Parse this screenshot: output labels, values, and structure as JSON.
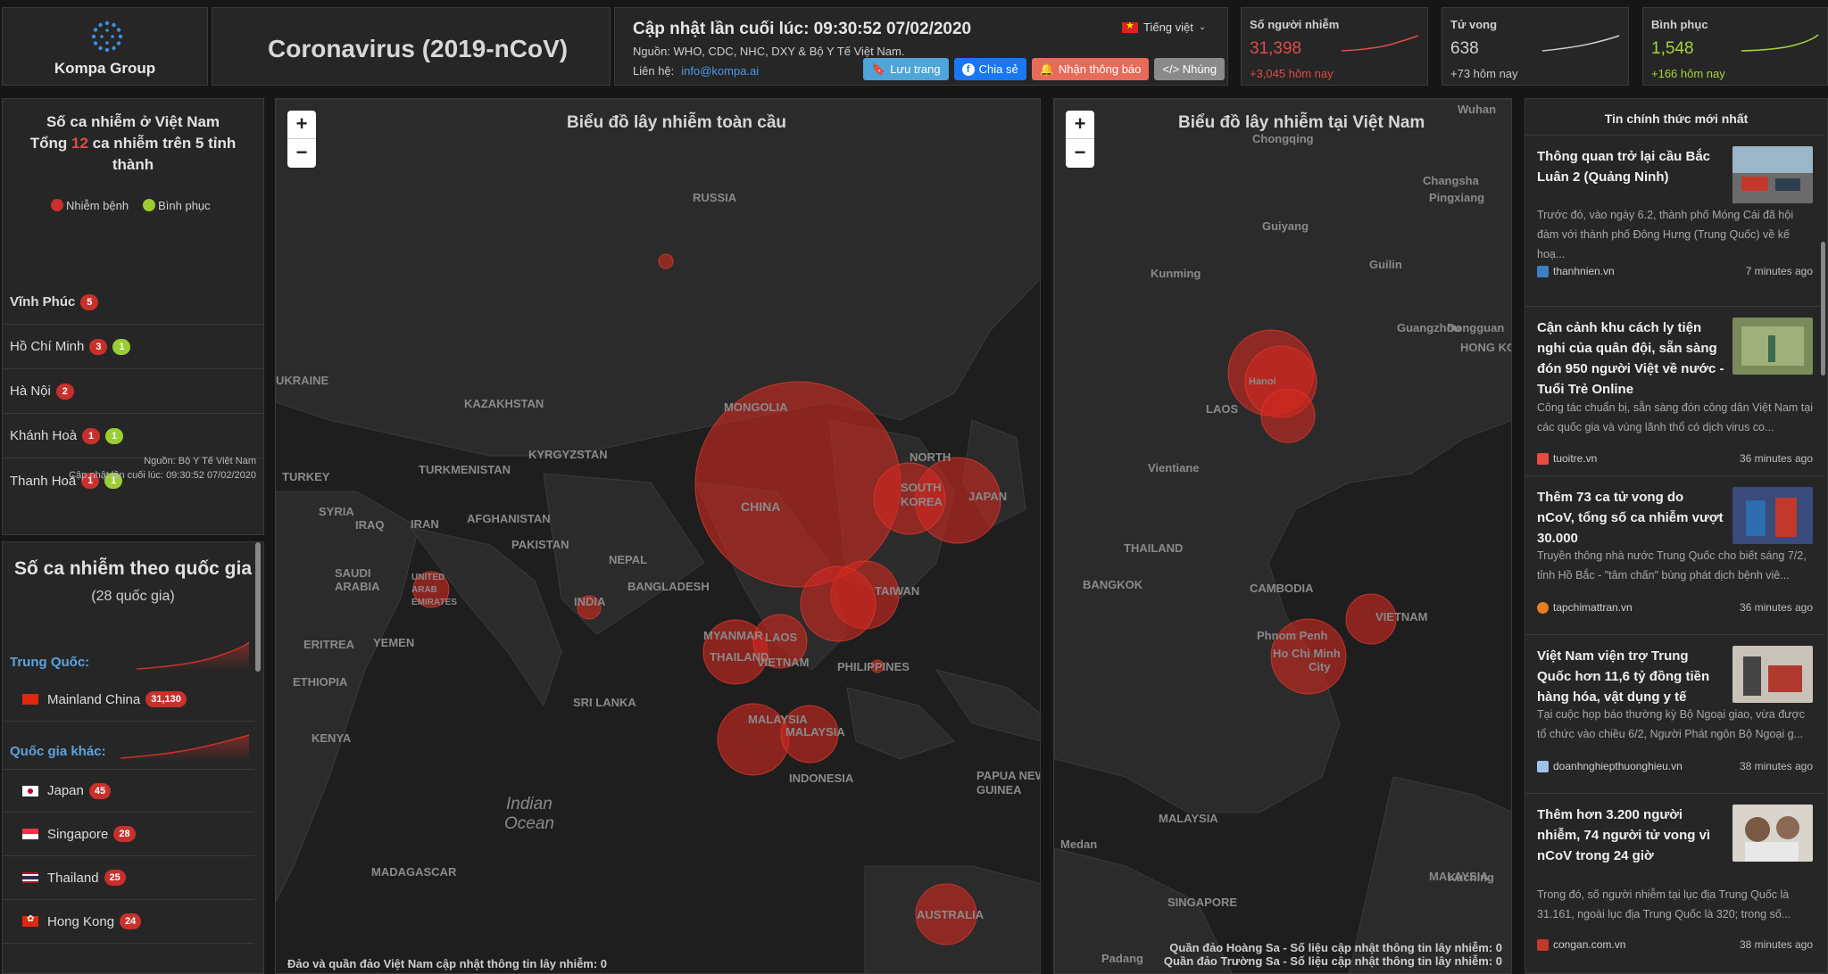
{
  "header": {
    "logo_text": "Kompa Group",
    "app_title": "Coronavirus (2019-nCoV)",
    "last_update": "Cập nhật lần cuối lúc: 09:30:52 07/02/2020",
    "source": "Nguồn: WHO, CDC, NHC, DXY & Bộ Y Tế Việt Nam.",
    "contact_label": "Liên hệ:",
    "contact_email": "info@kompa.ai",
    "language": "Tiếng việt",
    "buttons": {
      "save": "Lưu trang",
      "share": "Chia sẻ",
      "notify": "Nhận thông báo",
      "embed": "</> Nhúng"
    }
  },
  "stats": [
    {
      "label": "Số người nhiễm",
      "value": "31,398",
      "delta": "+3,045 hôm nay",
      "color": "#e24a4a"
    },
    {
      "label": "Tử vong",
      "value": "638",
      "delta": "+73 hôm nay",
      "color": "#d0d0d0"
    },
    {
      "label": "Bình phục",
      "value": "1,548",
      "delta": "+166 hôm nay",
      "color": "#a5d43a"
    }
  ],
  "vietnam": {
    "title_line1": "Số ca nhiễm ở Việt Nam",
    "title_pre": "Tổng",
    "title_count": "12",
    "title_post": "ca nhiễm trên 5 tỉnh thành",
    "legend_infected": "Nhiễm bệnh",
    "legend_recovered": "Bình phục",
    "provinces": [
      {
        "name": "Vĩnh Phúc",
        "infected": "5",
        "recovered": ""
      },
      {
        "name": "Hồ Chí Minh",
        "infected": "3",
        "recovered": "1"
      },
      {
        "name": "Hà Nội",
        "infected": "2",
        "recovered": ""
      },
      {
        "name": "Khánh Hoà",
        "infected": "1",
        "recovered": "1"
      },
      {
        "name": "Thanh Hoá",
        "infected": "1",
        "recovered": "1"
      }
    ],
    "source": "Nguồn: Bộ Y Tế Việt Nam",
    "updated": "Cập nhật lần cuối lúc: 09:30:52 07/02/2020"
  },
  "countries": {
    "title": "Số ca nhiễm theo quốc gia",
    "subtitle": "(28 quốc gia)",
    "group_china": "Trung Quốc:",
    "group_other": "Quốc gia khác:",
    "china": [
      {
        "name": "Mainland China",
        "count": "31,130"
      }
    ],
    "other": [
      {
        "name": "Japan",
        "count": "45"
      },
      {
        "name": "Singapore",
        "count": "28"
      },
      {
        "name": "Thailand",
        "count": "25"
      },
      {
        "name": "Hong Kong",
        "count": "24"
      }
    ]
  },
  "map_global": {
    "title": "Biểu đồ lây nhiễm toàn cầu",
    "footer": "Đảo và quần đảo Việt Nam cập nhật thông tin lây nhiễm: 0",
    "labels": [
      "RUSSIA",
      "MONGOLIA",
      "KAZAKHSTAN",
      "CHINA",
      "KYRGYZSTAN",
      "TURKMENISTAN",
      "TURKEY",
      "AFGHANISTAN",
      "SYRIA",
      "IRAQ",
      "IRAN",
      "PAKISTAN",
      "NEPAL",
      "INDIA",
      "BANGLADESH",
      "SAUDI ARABIA",
      "UNITED ARAB EMIRATES",
      "YEMEN",
      "ERITREA",
      "ETHIOPIA",
      "KENYA",
      "MYANMAR",
      "THAILAND",
      "VIETNAM",
      "LAOS",
      "PHILIPPINES",
      "MALAYSIA",
      "INDONESIA",
      "PAPUA NEW GUINEA",
      "SRI LANKA",
      "MADAGASCAR",
      "AUSTRALIA",
      "JAPAN",
      "SOUTH KOREA",
      "NORTH KOREA",
      "TAIWAN",
      "UKRAINE",
      "Indian Ocean"
    ]
  },
  "map_vn": {
    "title": "Biểu đồ lây nhiễm tại Việt Nam",
    "footer1": "Quần đảo Hoàng Sa - Số liệu cập nhật thông tin lây nhiễm: 0",
    "footer2": "Quần đảo Trường Sa - Số liệu cập nhật thông tin lây nhiễm: 0",
    "labels": [
      "Wuhan",
      "Chongqing",
      "Changsha",
      "Pingxiang",
      "Guiyang",
      "Kunming",
      "Guilin",
      "Guangzhou",
      "Dongguan",
      "HONG KONG",
      "LAOS",
      "Vientiane",
      "THAILAND",
      "BANGKOK",
      "CAMBODIA",
      "Phnom Penh",
      "Ho Chi Minh City",
      "VIETNAM",
      "MALAYSIA",
      "SINGAPORE",
      "Medan",
      "Padang",
      "Kuching",
      "Hanoi"
    ]
  },
  "news": {
    "header": "Tin chính thức mới nhất",
    "items": [
      {
        "title": "Thông quan trở lại cầu Bắc Luân 2 (Quảng Ninh)",
        "desc": "Trước đó, vào ngày 6.2, thành phố Móng Cái đã hội đàm với thành phố Đông Hưng (Trung Quốc) về kế hoạ...",
        "source": "thanhnien.vn",
        "time": "7 minutes ago"
      },
      {
        "title": "Cận cảnh khu cách ly tiện nghi của quân đội, sẵn sàng đón 950 người Việt về nước - Tuổi Trẻ Online",
        "desc": "Công tác chuẩn bị, sẵn sàng đón công dân Việt Nam tại các quốc gia và vùng lãnh thổ có dịch virus co...",
        "source": "tuoitre.vn",
        "time": "36 minutes ago"
      },
      {
        "title": "Thêm 73 ca tử vong do nCoV, tổng số ca nhiễm vượt 30.000",
        "desc": "Truyền thông nhà nước Trung Quốc cho biết sáng 7/2, tỉnh Hồ Bắc - \"tâm chấn\" bùng phát dịch bệnh viê...",
        "source": "tapchimattran.vn",
        "time": "36 minutes ago"
      },
      {
        "title": "Việt Nam viện trợ Trung Quốc hơn 11,6 tỷ đồng tiền hàng hóa, vật dụng y tế",
        "desc": "Tại cuộc họp báo thường kỳ Bộ Ngoại giao, vừa được tổ chức vào chiều 6/2, Người Phát ngôn Bộ Ngoại g...",
        "source": "doanhnghiepthuonghieu.vn",
        "time": "38 minutes ago"
      },
      {
        "title": "Thêm hơn 3.200 người nhiễm, 74 người tử vong vì nCoV trong 24 giờ",
        "desc": "Trong đó, số người nhiễm tại lục địa Trung Quốc là 31.161, ngoài lục địa Trung Quốc là 320; trong số...",
        "source": "congan.com.vn",
        "time": "38 minutes ago"
      }
    ]
  }
}
